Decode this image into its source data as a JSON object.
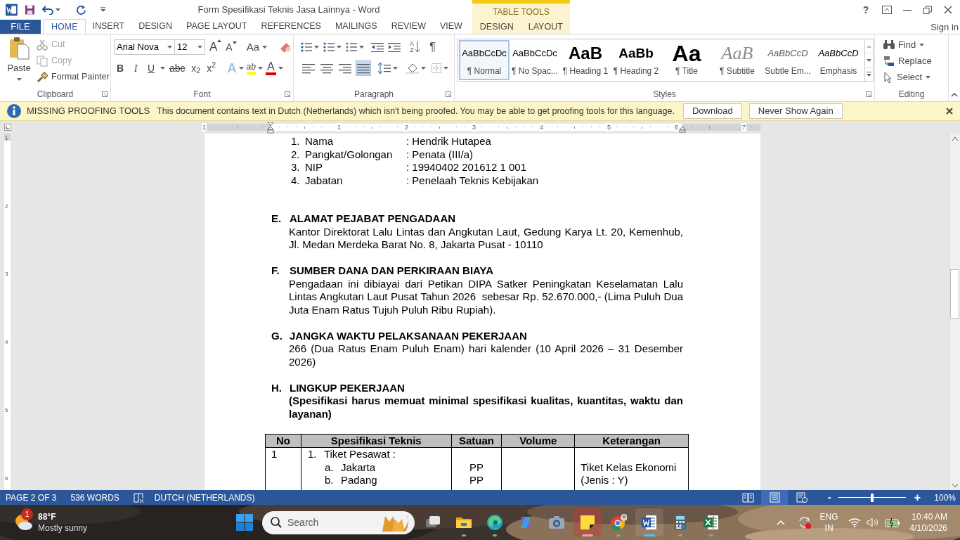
{
  "window": {
    "title": "Form Spesifikasi Teknis Jasa Lainnya - Word",
    "contextual_group": "TABLE TOOLS",
    "help": "?"
  },
  "tabs": [
    {
      "label": "FILE",
      "kind": "file",
      "selected": false
    },
    {
      "label": "HOME",
      "kind": "main",
      "selected": true
    },
    {
      "label": "INSERT",
      "kind": "main",
      "selected": false
    },
    {
      "label": "DESIGN",
      "kind": "main",
      "selected": false
    },
    {
      "label": "PAGE LAYOUT",
      "kind": "main",
      "selected": false
    },
    {
      "label": "REFERENCES",
      "kind": "main",
      "selected": false
    },
    {
      "label": "MAILINGS",
      "kind": "main",
      "selected": false
    },
    {
      "label": "REVIEW",
      "kind": "main",
      "selected": false
    },
    {
      "label": "VIEW",
      "kind": "main",
      "selected": false
    },
    {
      "label": "DESIGN",
      "kind": "contextual",
      "selected": false
    },
    {
      "label": "LAYOUT",
      "kind": "contextual",
      "selected": false
    }
  ],
  "account": {
    "sign_in": "Sign in"
  },
  "ribbon": {
    "clipboard": {
      "group": "Clipboard",
      "paste": "Paste",
      "cut": {
        "label": "Cut",
        "disabled": true
      },
      "copy": {
        "label": "Copy",
        "disabled": true
      },
      "format_painter": {
        "label": "Format Painter",
        "disabled": false
      }
    },
    "font": {
      "group": "Font",
      "name": "Arial Nova",
      "size": "12",
      "grow": "A",
      "shrink": "A",
      "change_case": "Aa",
      "effects": "A",
      "highlight": "ab",
      "font_color": "A",
      "buttons": [
        {
          "label": "B",
          "kind": "bold"
        },
        {
          "label": "I",
          "kind": "italic"
        },
        {
          "label": "U",
          "kind": "underline"
        },
        {
          "label": "abc",
          "kind": "strike"
        },
        {
          "label": "x$_{2}$",
          "kind": "sub"
        },
        {
          "label": "x$^{2}$",
          "kind": "sup"
        }
      ]
    },
    "paragraph": {
      "group": "Paragraph",
      "sort": "AZ",
      "pilcrow": "¶",
      "alignment": [
        {
          "kind": "left",
          "selected": false
        },
        {
          "kind": "center",
          "selected": false
        },
        {
          "kind": "right",
          "selected": false
        },
        {
          "kind": "justify",
          "selected": true
        }
      ]
    },
    "styles": {
      "group": "Styles",
      "items": [
        {
          "preview": "AaBbCcDc",
          "label": "¶ Normal",
          "kind": "normal",
          "selected": true
        },
        {
          "preview": "AaBbCcDc",
          "label": "¶ No Spac...",
          "kind": "plain",
          "selected": false
        },
        {
          "preview": "AaB",
          "label": "¶ Heading 1",
          "kind": "heading1",
          "selected": false
        },
        {
          "preview": "AaBb",
          "label": "¶ Heading 2",
          "kind": "heading2",
          "selected": false
        },
        {
          "preview": "Aa",
          "label": "¶ Title",
          "kind": "title",
          "selected": false
        },
        {
          "preview": "AaB",
          "label": "¶ Subtitle",
          "kind": "subtitle",
          "selected": false
        },
        {
          "preview": "AaBbCcD",
          "label": "Subtle Em...",
          "kind": "subtle",
          "selected": false
        },
        {
          "preview": "AaBbCcD",
          "label": "Emphasis",
          "kind": "emphasis",
          "selected": false
        }
      ]
    },
    "editing": {
      "group": "Editing",
      "find": "Find",
      "replace": "Replace",
      "select": "Select"
    }
  },
  "infobar": {
    "title": "MISSING PROOFING TOOLS",
    "message": "This document contains text in Dutch (Netherlands) which isn't being proofed. You may be able to get proofing tools for this language.",
    "buttons": [
      "Download",
      "Never Show Again"
    ]
  },
  "ruler": {
    "numbers": [
      "1",
      "1",
      "2",
      "3",
      "4",
      "5",
      "6",
      "7"
    ]
  },
  "vertical_ruler": {
    "numbers": [
      "1",
      "2",
      "3",
      "4",
      "5",
      "6"
    ]
  },
  "document": {
    "blocks": [
      {
        "kind": "list",
        "items": [
          {
            "number": "1.",
            "label": "Nama",
            "value": ": Hendrik Hutapea"
          },
          {
            "number": "2.",
            "label": "Pangkat/Golongan",
            "value": ": Penata (III/a)"
          },
          {
            "number": "3.",
            "label": "NIP",
            "value": ": 19940402 201612 1 001"
          },
          {
            "number": "4.",
            "label": "Jabatan",
            "value": ": Penelaah Teknis Kebijakan"
          }
        ]
      },
      {
        "kind": "section",
        "letter": "E.",
        "title": "ALAMAT PEJABAT PENGADAAN",
        "body": "Kantor Direktorat Lalu Lintas dan Angkutan Laut, Gedung Karya Lt. 20, Kemenhub, Jl. Medan Merdeka Barat No. 8, Jakarta Pusat - 10110",
        "emphasis": false
      },
      {
        "kind": "section",
        "letter": "F.",
        "title": "SUMBER DANA DAN PERKIRAAN BIAYA",
        "body": "Pengadaan ini dibiayai dari Petikan DIPA Satker Peningkatan Keselamatan Lalu Lintas Angkutan Laut Pusat Tahun 2026  sebesar Rp. 52.670.000,- (Lima Puluh Dua Juta Enam Ratus Tujuh Puluh Ribu Rupiah).",
        "emphasis": false
      },
      {
        "kind": "section",
        "letter": "G.",
        "title": "JANGKA WAKTU PELAKSANAAN PEKERJAAN",
        "body": "266 (Dua Ratus Enam Puluh Enam) hari kalender (10 April 2026 – 31 Desember 2026)",
        "emphasis": false
      },
      {
        "kind": "section",
        "letter": "H.",
        "title": "LINGKUP PEKERJAAN",
        "body": "(Spesifikasi harus memuat minimal spesifikasi kualitas, kuantitas, waktu dan layanan)",
        "emphasis": true
      },
      {
        "kind": "table",
        "columns": [
          "No",
          "Spesifikasi Teknis",
          "Satuan",
          "Volume",
          "Keterangan"
        ],
        "rows": [
          {
            "no": "1",
            "spec": {
              "number": "1.",
              "title": "Tiket Pesawat :",
              "items": [
                {
                  "letter": "a.",
                  "name": "Jakarta"
                },
                {
                  "letter": "b.",
                  "name": "Padang"
                }
              ]
            },
            "satuan": [
              "PP",
              "PP"
            ],
            "keterangan": "Tiket Kelas Ekonomi (Jenis : Y)"
          }
        ]
      }
    ]
  },
  "status_bar": {
    "page": "PAGE 2 OF 3",
    "words": "536 WORDS",
    "language": "DUTCH (NETHERLANDS)",
    "views": [
      {
        "kind": "read",
        "selected": false
      },
      {
        "kind": "print",
        "selected": true
      },
      {
        "kind": "web",
        "selected": false
      }
    ],
    "zoom": {
      "zoom_out": "-",
      "zoom_in": "+",
      "level": 0.5,
      "value": "100%"
    }
  },
  "taskbar": {
    "weather": {
      "badge": "1",
      "temperature": "88°F",
      "condition": "Mostly sunny"
    },
    "search": {
      "placeholder": "Search"
    },
    "apps": [
      {
        "kind": "taskview",
        "open": false,
        "selected": false,
        "alert": false
      },
      {
        "kind": "folder",
        "open": true,
        "selected": false,
        "alert": false
      },
      {
        "kind": "swirl",
        "open": true,
        "selected": false,
        "alert": false
      },
      {
        "kind": "loop",
        "open": false,
        "selected": false,
        "alert": false
      },
      {
        "kind": "camera",
        "open": false,
        "selected": false,
        "alert": false
      },
      {
        "kind": "note",
        "open": true,
        "selected": false,
        "alert": true
      },
      {
        "kind": "circle",
        "open": true,
        "selected": false,
        "alert": false
      },
      {
        "kind": "document",
        "open": true,
        "selected": true,
        "alert": false
      },
      {
        "kind": "calculator",
        "open": true,
        "selected": false,
        "alert": false
      },
      {
        "kind": "sheet",
        "open": true,
        "selected": false,
        "alert": false
      }
    ],
    "tray": {
      "language": "ENG",
      "region": "IN",
      "time": "10:40 AM",
      "date": "4/10/2026"
    }
  }
}
